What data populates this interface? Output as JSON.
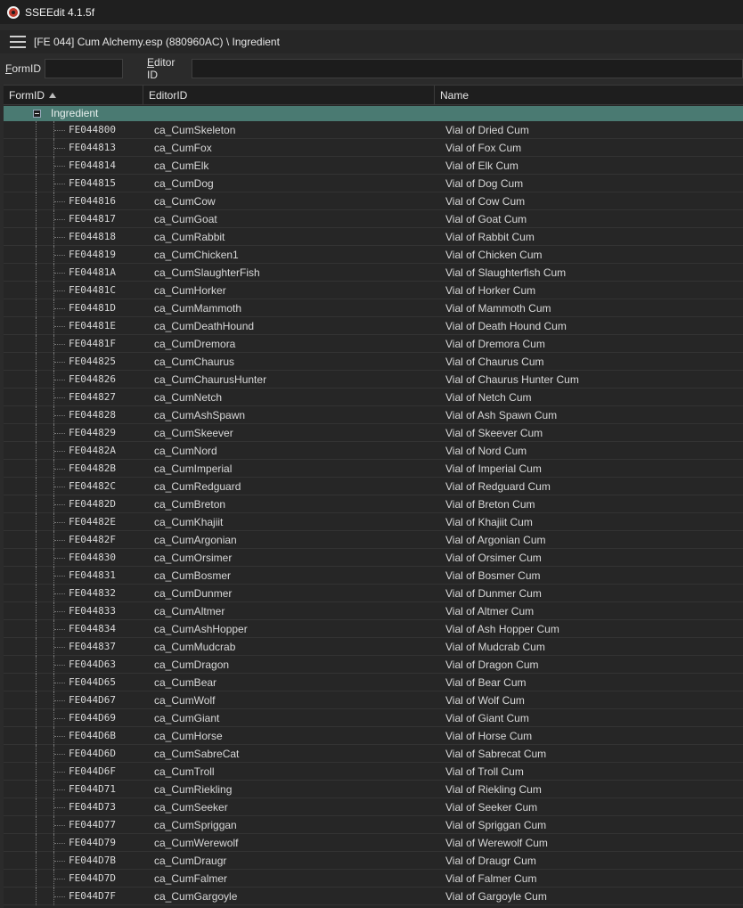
{
  "window": {
    "title": "SSEEdit 4.1.5f"
  },
  "path": {
    "text": "[FE 044] Cum Alchemy.esp (880960AC) \\ Ingredient"
  },
  "filter": {
    "formid_label": "FormID",
    "formid_value": "",
    "editorid_label": "Editor ID",
    "editorid_value": ""
  },
  "columns": {
    "formid": "FormID",
    "editorid": "EditorID",
    "name": "Name"
  },
  "group": {
    "label": "Ingredient"
  },
  "rows": [
    {
      "formid": "FE044800",
      "editorid": "ca_CumSkeleton",
      "name": "Vial of Dried Cum"
    },
    {
      "formid": "FE044813",
      "editorid": "ca_CumFox",
      "name": "Vial of Fox Cum"
    },
    {
      "formid": "FE044814",
      "editorid": "ca_CumElk",
      "name": "Vial of Elk Cum"
    },
    {
      "formid": "FE044815",
      "editorid": "ca_CumDog",
      "name": "Vial of Dog Cum"
    },
    {
      "formid": "FE044816",
      "editorid": "ca_CumCow",
      "name": "Vial of Cow Cum"
    },
    {
      "formid": "FE044817",
      "editorid": "ca_CumGoat",
      "name": "Vial of Goat Cum"
    },
    {
      "formid": "FE044818",
      "editorid": "ca_CumRabbit",
      "name": "Vial of Rabbit Cum"
    },
    {
      "formid": "FE044819",
      "editorid": "ca_CumChicken1",
      "name": "Vial of Chicken Cum"
    },
    {
      "formid": "FE04481A",
      "editorid": "ca_CumSlaughterFish",
      "name": "Vial of Slaughterfish Cum"
    },
    {
      "formid": "FE04481C",
      "editorid": "ca_CumHorker",
      "name": "Vial of Horker Cum"
    },
    {
      "formid": "FE04481D",
      "editorid": "ca_CumMammoth",
      "name": "Vial of Mammoth Cum"
    },
    {
      "formid": "FE04481E",
      "editorid": "ca_CumDeathHound",
      "name": "Vial of Death Hound Cum"
    },
    {
      "formid": "FE04481F",
      "editorid": "ca_CumDremora",
      "name": "Vial of Dremora Cum"
    },
    {
      "formid": "FE044825",
      "editorid": "ca_CumChaurus",
      "name": "Vial of Chaurus Cum"
    },
    {
      "formid": "FE044826",
      "editorid": "ca_CumChaurusHunter",
      "name": "Vial of Chaurus Hunter Cum"
    },
    {
      "formid": "FE044827",
      "editorid": "ca_CumNetch",
      "name": "Vial of Netch Cum"
    },
    {
      "formid": "FE044828",
      "editorid": "ca_CumAshSpawn",
      "name": "Vial of Ash Spawn Cum"
    },
    {
      "formid": "FE044829",
      "editorid": "ca_CumSkeever",
      "name": "Vial of Skeever Cum"
    },
    {
      "formid": "FE04482A",
      "editorid": "ca_CumNord",
      "name": "Vial of Nord Cum"
    },
    {
      "formid": "FE04482B",
      "editorid": "ca_CumImperial",
      "name": "Vial of Imperial Cum"
    },
    {
      "formid": "FE04482C",
      "editorid": "ca_CumRedguard",
      "name": "Vial of Redguard Cum"
    },
    {
      "formid": "FE04482D",
      "editorid": "ca_CumBreton",
      "name": "Vial of Breton Cum"
    },
    {
      "formid": "FE04482E",
      "editorid": "ca_CumKhajiit",
      "name": "Vial of Khajiit Cum"
    },
    {
      "formid": "FE04482F",
      "editorid": "ca_CumArgonian",
      "name": "Vial of Argonian Cum"
    },
    {
      "formid": "FE044830",
      "editorid": "ca_CumOrsimer",
      "name": "Vial of Orsimer Cum"
    },
    {
      "formid": "FE044831",
      "editorid": "ca_CumBosmer",
      "name": "Vial of Bosmer Cum"
    },
    {
      "formid": "FE044832",
      "editorid": "ca_CumDunmer",
      "name": "Vial of Dunmer Cum"
    },
    {
      "formid": "FE044833",
      "editorid": "ca_CumAltmer",
      "name": "Vial of Altmer Cum"
    },
    {
      "formid": "FE044834",
      "editorid": "ca_CumAshHopper",
      "name": "Vial of Ash Hopper Cum"
    },
    {
      "formid": "FE044837",
      "editorid": "ca_CumMudcrab",
      "name": "Vial of Mudcrab Cum"
    },
    {
      "formid": "FE044D63",
      "editorid": "ca_CumDragon",
      "name": "Vial of Dragon Cum"
    },
    {
      "formid": "FE044D65",
      "editorid": "ca_CumBear",
      "name": "Vial of Bear Cum"
    },
    {
      "formid": "FE044D67",
      "editorid": "ca_CumWolf",
      "name": "Vial of Wolf Cum"
    },
    {
      "formid": "FE044D69",
      "editorid": "ca_CumGiant",
      "name": "Vial of Giant Cum"
    },
    {
      "formid": "FE044D6B",
      "editorid": "ca_CumHorse",
      "name": "Vial of Horse Cum"
    },
    {
      "formid": "FE044D6D",
      "editorid": "ca_CumSabreCat",
      "name": "Vial of Sabrecat Cum"
    },
    {
      "formid": "FE044D6F",
      "editorid": "ca_CumTroll",
      "name": "Vial of Troll Cum"
    },
    {
      "formid": "FE044D71",
      "editorid": "ca_CumRiekling",
      "name": "Vial of Riekling Cum"
    },
    {
      "formid": "FE044D73",
      "editorid": "ca_CumSeeker",
      "name": "Vial of Seeker Cum"
    },
    {
      "formid": "FE044D77",
      "editorid": "ca_CumSpriggan",
      "name": "Vial of Spriggan Cum"
    },
    {
      "formid": "FE044D79",
      "editorid": "ca_CumWerewolf",
      "name": "Vial of Werewolf Cum"
    },
    {
      "formid": "FE044D7B",
      "editorid": "ca_CumDraugr",
      "name": "Vial of Draugr Cum"
    },
    {
      "formid": "FE044D7D",
      "editorid": "ca_CumFalmer",
      "name": "Vial of Falmer Cum"
    },
    {
      "formid": "FE044D7F",
      "editorid": "ca_CumGargoyle",
      "name": "Vial of Gargoyle Cum"
    }
  ]
}
